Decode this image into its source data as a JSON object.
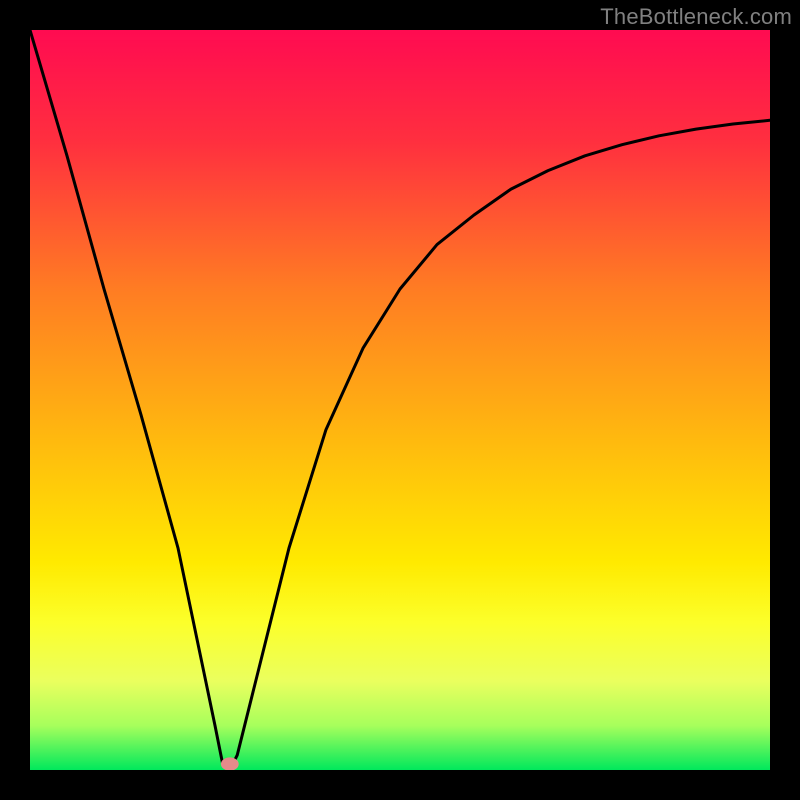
{
  "watermark": "TheBottleneck.com",
  "chart_data": {
    "type": "line",
    "title": "",
    "xlabel": "",
    "ylabel": "",
    "xlim": [
      0,
      100
    ],
    "ylim": [
      0,
      100
    ],
    "gradient_stops": [
      {
        "offset": 0,
        "color": "#ff0b51"
      },
      {
        "offset": 15,
        "color": "#ff2f3f"
      },
      {
        "offset": 35,
        "color": "#ff7c23"
      },
      {
        "offset": 55,
        "color": "#ffb80f"
      },
      {
        "offset": 72,
        "color": "#ffea00"
      },
      {
        "offset": 80,
        "color": "#fcff2a"
      },
      {
        "offset": 88,
        "color": "#eaff5e"
      },
      {
        "offset": 94,
        "color": "#a7ff5c"
      },
      {
        "offset": 100,
        "color": "#00e85c"
      }
    ],
    "series": [
      {
        "name": "main-curve",
        "x": [
          0,
          5,
          10,
          15,
          20,
          25,
          26,
          27,
          28,
          30,
          35,
          40,
          45,
          50,
          55,
          60,
          65,
          70,
          75,
          80,
          85,
          90,
          95,
          100
        ],
        "values": [
          100,
          83,
          65,
          48,
          30,
          6,
          1,
          0,
          2,
          10,
          30,
          46,
          57,
          65,
          71,
          75,
          78.5,
          81,
          83,
          84.5,
          85.7,
          86.6,
          87.3,
          87.8
        ]
      }
    ],
    "marker": {
      "x": 27,
      "y": 0.8,
      "rx": 1.2,
      "ry": 0.9,
      "color": "#e58b8b"
    }
  }
}
